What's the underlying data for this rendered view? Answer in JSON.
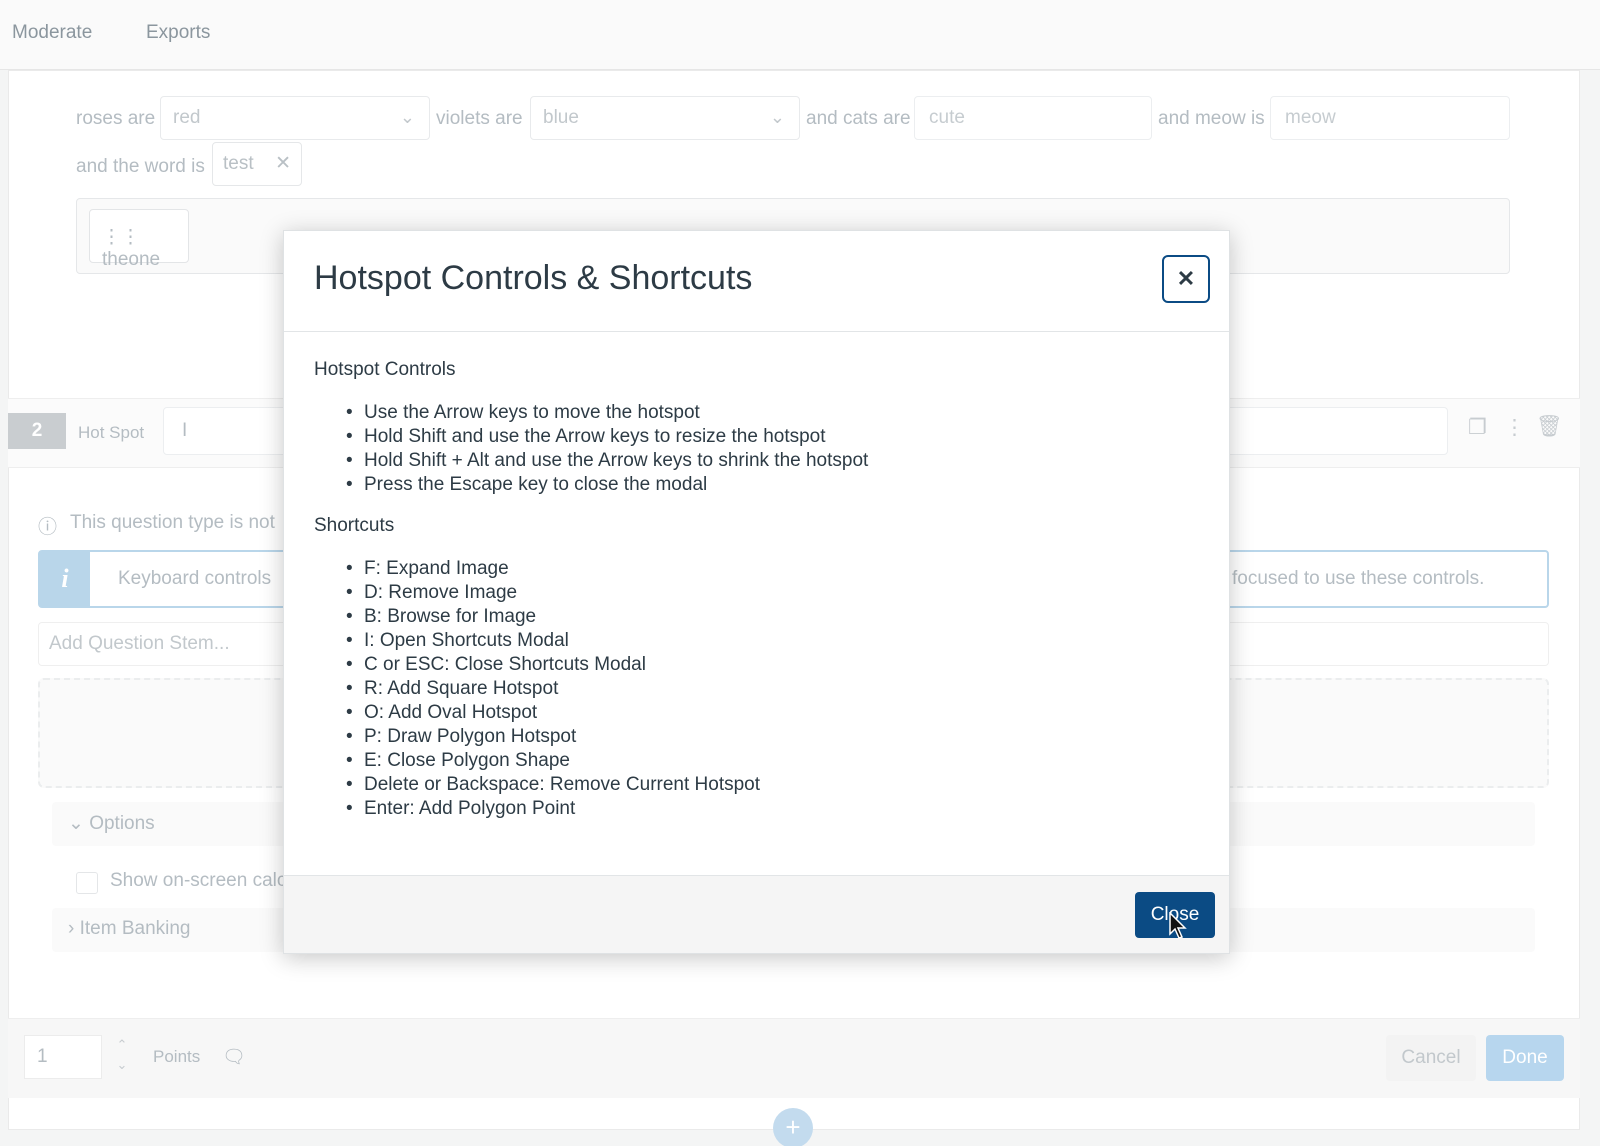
{
  "topnav": {
    "items": [
      "Moderate",
      "Exports"
    ]
  },
  "fill_blank": {
    "label1": "roses are",
    "select1": "red",
    "label2": "violets are",
    "select2": "blue",
    "label3": "and cats are",
    "input3": "cute",
    "label4": "and meow is",
    "input4": "meow",
    "label5": "and the word is",
    "token": "test",
    "chip": "theone"
  },
  "question": {
    "number": "2",
    "type_label": "Hot Spot",
    "title_value": "I",
    "unsupported_notice": "This question type is not",
    "keyboard_info_left": "Keyboard controls",
    "keyboard_info_right": "focused to use these controls.",
    "stem_placeholder": "Add Question Stem...",
    "options_label": "Options",
    "calc_label": "Show on-screen calc",
    "item_banking_label": "Item Banking"
  },
  "footer": {
    "points_value": "1",
    "points_label": "Points",
    "cancel": "Cancel",
    "done": "Done"
  },
  "modal": {
    "title": "Hotspot Controls & Shortcuts",
    "close_icon": "close-icon",
    "controls_heading": "Hotspot Controls",
    "controls": [
      "Use the Arrow keys to move the hotspot",
      "Hold Shift and use the Arrow keys to resize the hotspot",
      "Hold Shift + Alt and use the Arrow keys to shrink the hotspot",
      "Press the Escape key to close the modal"
    ],
    "shortcuts_heading": "Shortcuts",
    "shortcuts": [
      "F: Expand Image",
      "D: Remove Image",
      "B: Browse for Image",
      "I: Open Shortcuts Modal",
      "C or ESC: Close Shortcuts Modal",
      "R: Add Square Hotspot",
      "O: Add Oval Hotspot",
      "P: Draw Polygon Hotspot",
      "E: Close Polygon Shape",
      "Delete or Backspace: Remove Current Hotspot",
      "Enter: Add Polygon Point"
    ],
    "close_button": "Close"
  },
  "colors": {
    "primary": "#0b4b84",
    "done_disabled": "#b7d6ee",
    "info": "#b9d6ea"
  }
}
